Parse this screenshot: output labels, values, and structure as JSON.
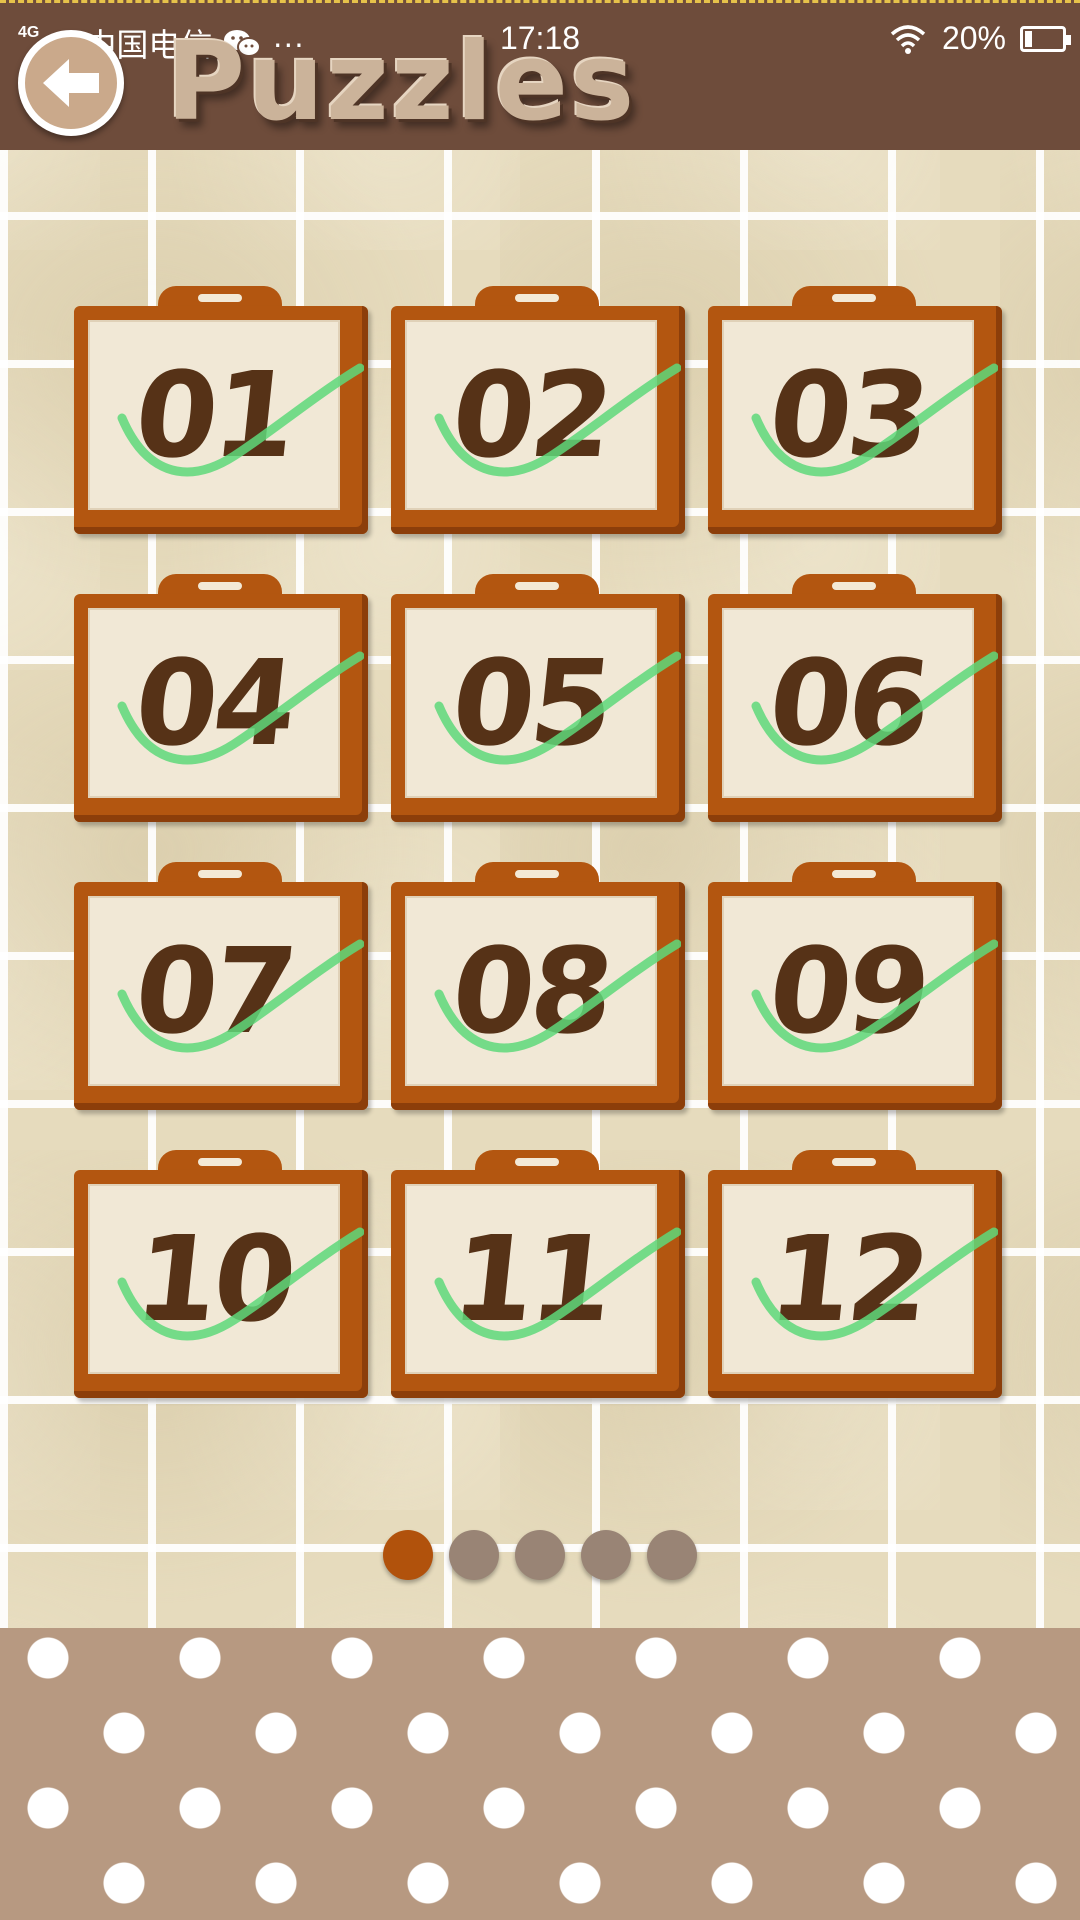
{
  "status_bar": {
    "network": "4G",
    "carrier": "中国电信",
    "more": "···",
    "time": "17:18",
    "battery": "20%",
    "battery_level": 0.2
  },
  "header": {
    "title": "Puzzles",
    "back_icon": "back-arrow-icon"
  },
  "puzzles": {
    "items": [
      {
        "label": "01",
        "completed": true
      },
      {
        "label": "02",
        "completed": true
      },
      {
        "label": "03",
        "completed": true
      },
      {
        "label": "04",
        "completed": true
      },
      {
        "label": "05",
        "completed": true
      },
      {
        "label": "06",
        "completed": true
      },
      {
        "label": "07",
        "completed": true
      },
      {
        "label": "08",
        "completed": true
      },
      {
        "label": "09",
        "completed": true
      },
      {
        "label": "10",
        "completed": true
      },
      {
        "label": "11",
        "completed": true
      },
      {
        "label": "12",
        "completed": true
      }
    ]
  },
  "pagination": {
    "pages": 5,
    "current": 1
  },
  "colors": {
    "header_bg": "#6e4c3b",
    "card_frame": "#b35610",
    "check": "#5ed87a",
    "dot_active": "#b1520c",
    "dot_inactive": "#998475"
  }
}
